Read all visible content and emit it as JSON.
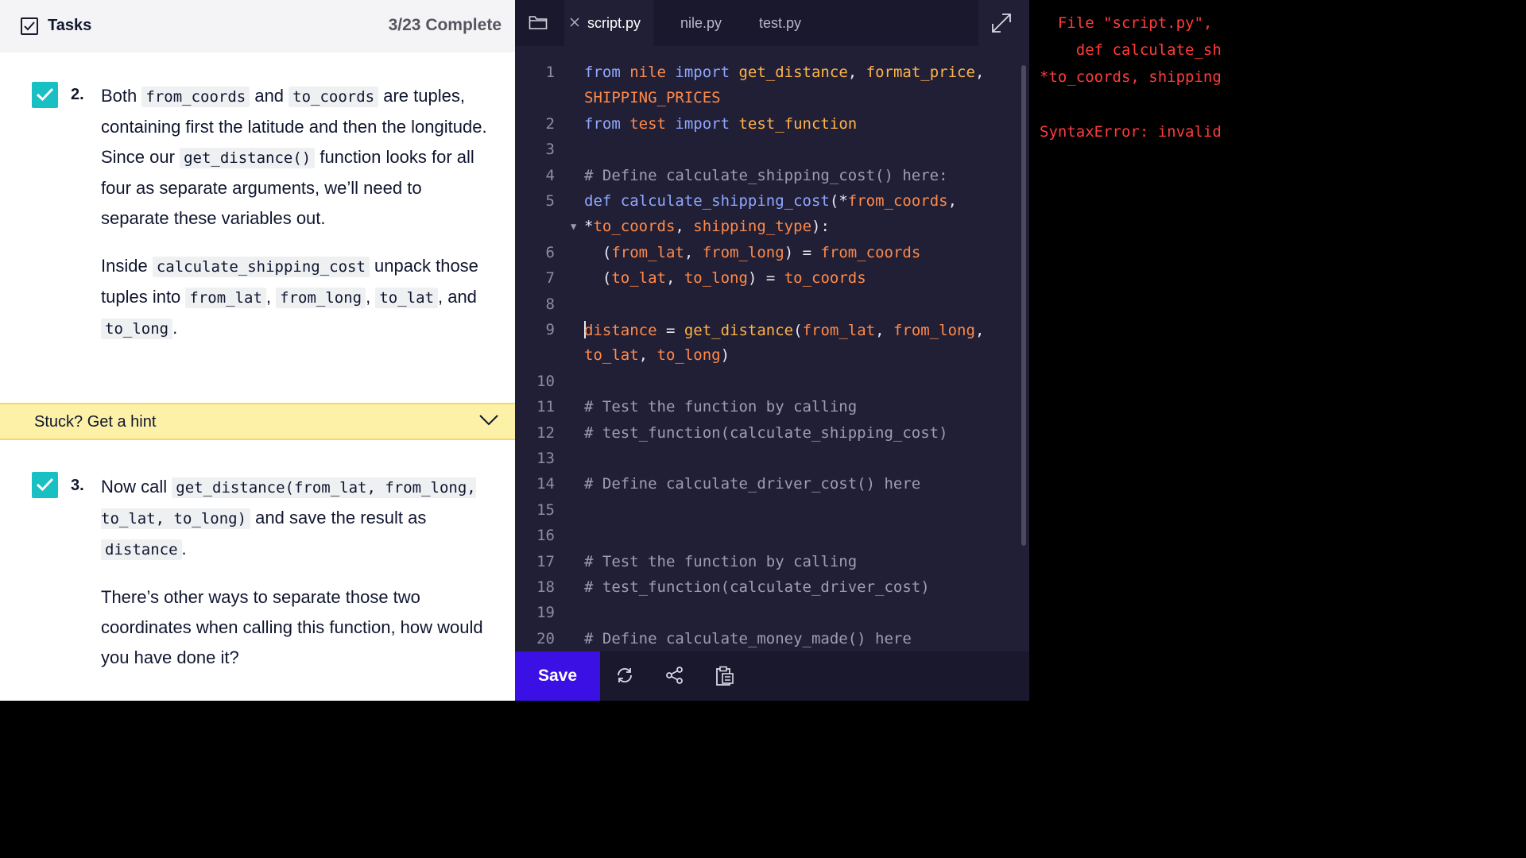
{
  "tasks": {
    "title": "Tasks",
    "progress": "3/23 Complete",
    "task2": {
      "number": "2.",
      "p1": [
        "Both ",
        "from_coords",
        " and ",
        "to_coords",
        " are tuples, containing first the latitude and then the longitude. Since our ",
        "get_distance()",
        " function looks for all four as separate arguments, we’ll need to separate these variables out."
      ],
      "p2": [
        "Inside ",
        "calculate_shipping_cost",
        " unpack those tuples into ",
        "from_lat",
        ", ",
        "from_long",
        ", ",
        "to_lat",
        ", and ",
        "to_long",
        "."
      ]
    },
    "hint": "Stuck? Get a hint",
    "task3": {
      "number": "3.",
      "p1": [
        "Now call ",
        "get_distance(from_lat, from_long, to_lat, to_long)",
        " and save the result as ",
        "distance",
        "."
      ],
      "p2": "There’s other ways to separate those two coordinates when calling this function, how would you have done it?"
    }
  },
  "editor": {
    "tabs": [
      "script.py",
      "nile.py",
      "test.py"
    ],
    "active_tab": "script.py",
    "save_label": "Save",
    "code_lines": [
      {
        "n": "1",
        "segs": [
          [
            "kw",
            "from "
          ],
          [
            "id",
            "nile "
          ],
          [
            "kw",
            "import "
          ],
          [
            "fn",
            "get_distance"
          ],
          [
            "op",
            ", "
          ],
          [
            "fn",
            "format_price"
          ],
          [
            "op",
            ","
          ]
        ]
      },
      {
        "n": "",
        "segs": [
          [
            "id",
            "SHIPPING_PRICES"
          ]
        ]
      },
      {
        "n": "2",
        "segs": [
          [
            "kw",
            "from "
          ],
          [
            "id",
            "test "
          ],
          [
            "kw",
            "import "
          ],
          [
            "fn",
            "test_function"
          ]
        ]
      },
      {
        "n": "3",
        "segs": []
      },
      {
        "n": "4",
        "segs": [
          [
            "cm",
            "# Define calculate_shipping_cost() here:"
          ]
        ]
      },
      {
        "n": "5",
        "segs": [
          [
            "kw",
            "def "
          ],
          [
            "kw",
            "calculate_shipping_cost"
          ],
          [
            "op",
            "(*"
          ],
          [
            "id",
            "from_coords"
          ],
          [
            "op",
            ","
          ]
        ]
      },
      {
        "n": "",
        "segs": [
          [
            "op",
            "*"
          ],
          [
            "id",
            "to_coords"
          ],
          [
            "op",
            ", "
          ],
          [
            "id",
            "shipping_type"
          ],
          [
            "op",
            "):"
          ]
        ]
      },
      {
        "n": "6",
        "segs": [
          [
            "op",
            "  ("
          ],
          [
            "id",
            "from_lat"
          ],
          [
            "op",
            ", "
          ],
          [
            "id",
            "from_long"
          ],
          [
            "op",
            ") = "
          ],
          [
            "id",
            "from_coords"
          ]
        ]
      },
      {
        "n": "7",
        "segs": [
          [
            "op",
            "  ("
          ],
          [
            "id",
            "to_lat"
          ],
          [
            "op",
            ", "
          ],
          [
            "id",
            "to_long"
          ],
          [
            "op",
            ") = "
          ],
          [
            "id",
            "to_coords"
          ]
        ]
      },
      {
        "n": "8",
        "segs": []
      },
      {
        "n": "9",
        "segs": [
          [
            "caret",
            ""
          ],
          [
            "id",
            "distance"
          ],
          [
            "op",
            " = "
          ],
          [
            "fn",
            "get_distance"
          ],
          [
            "op",
            "("
          ],
          [
            "id",
            "from_lat"
          ],
          [
            "op",
            ", "
          ],
          [
            "id",
            "from_long"
          ],
          [
            "op",
            ","
          ]
        ]
      },
      {
        "n": "",
        "segs": [
          [
            "id",
            "to_lat"
          ],
          [
            "op",
            ", "
          ],
          [
            "id",
            "to_long"
          ],
          [
            "op",
            ")"
          ]
        ]
      },
      {
        "n": "10",
        "segs": []
      },
      {
        "n": "11",
        "segs": [
          [
            "cm",
            "# Test the function by calling"
          ]
        ]
      },
      {
        "n": "12",
        "segs": [
          [
            "cm",
            "# test_function(calculate_shipping_cost)"
          ]
        ]
      },
      {
        "n": "13",
        "segs": []
      },
      {
        "n": "14",
        "segs": [
          [
            "cm",
            "# Define calculate_driver_cost() here"
          ]
        ]
      },
      {
        "n": "15",
        "segs": []
      },
      {
        "n": "16",
        "segs": []
      },
      {
        "n": "17",
        "segs": [
          [
            "cm",
            "# Test the function by calling"
          ]
        ]
      },
      {
        "n": "18",
        "segs": [
          [
            "cm",
            "# test_function(calculate_driver_cost)"
          ]
        ]
      },
      {
        "n": "19",
        "segs": []
      },
      {
        "n": "20",
        "segs": [
          [
            "cm",
            "# Define calculate_money_made() here"
          ]
        ]
      }
    ]
  },
  "terminal": {
    "lines": [
      "  File \"script.py\",",
      "    def calculate_sh",
      "*to_coords, shipping",
      "",
      "SyntaxError: invalid"
    ]
  },
  "icons": {
    "tasks_header": "checkbox-icon",
    "task_check": "check-icon",
    "hint": "chevron-down-icon",
    "folder": "folder-icon",
    "tab_close": "close-icon",
    "expand": "expand-icon",
    "reset": "refresh-icon",
    "share": "share-icon",
    "clipboard": "clipboard-icon"
  },
  "colors": {
    "accent_teal": "#18c0c4",
    "save_button": "#3a10e5",
    "hint_bg": "#fdf1a7",
    "editor_bg": "#211f35",
    "error_red": "#ff3b3b"
  }
}
